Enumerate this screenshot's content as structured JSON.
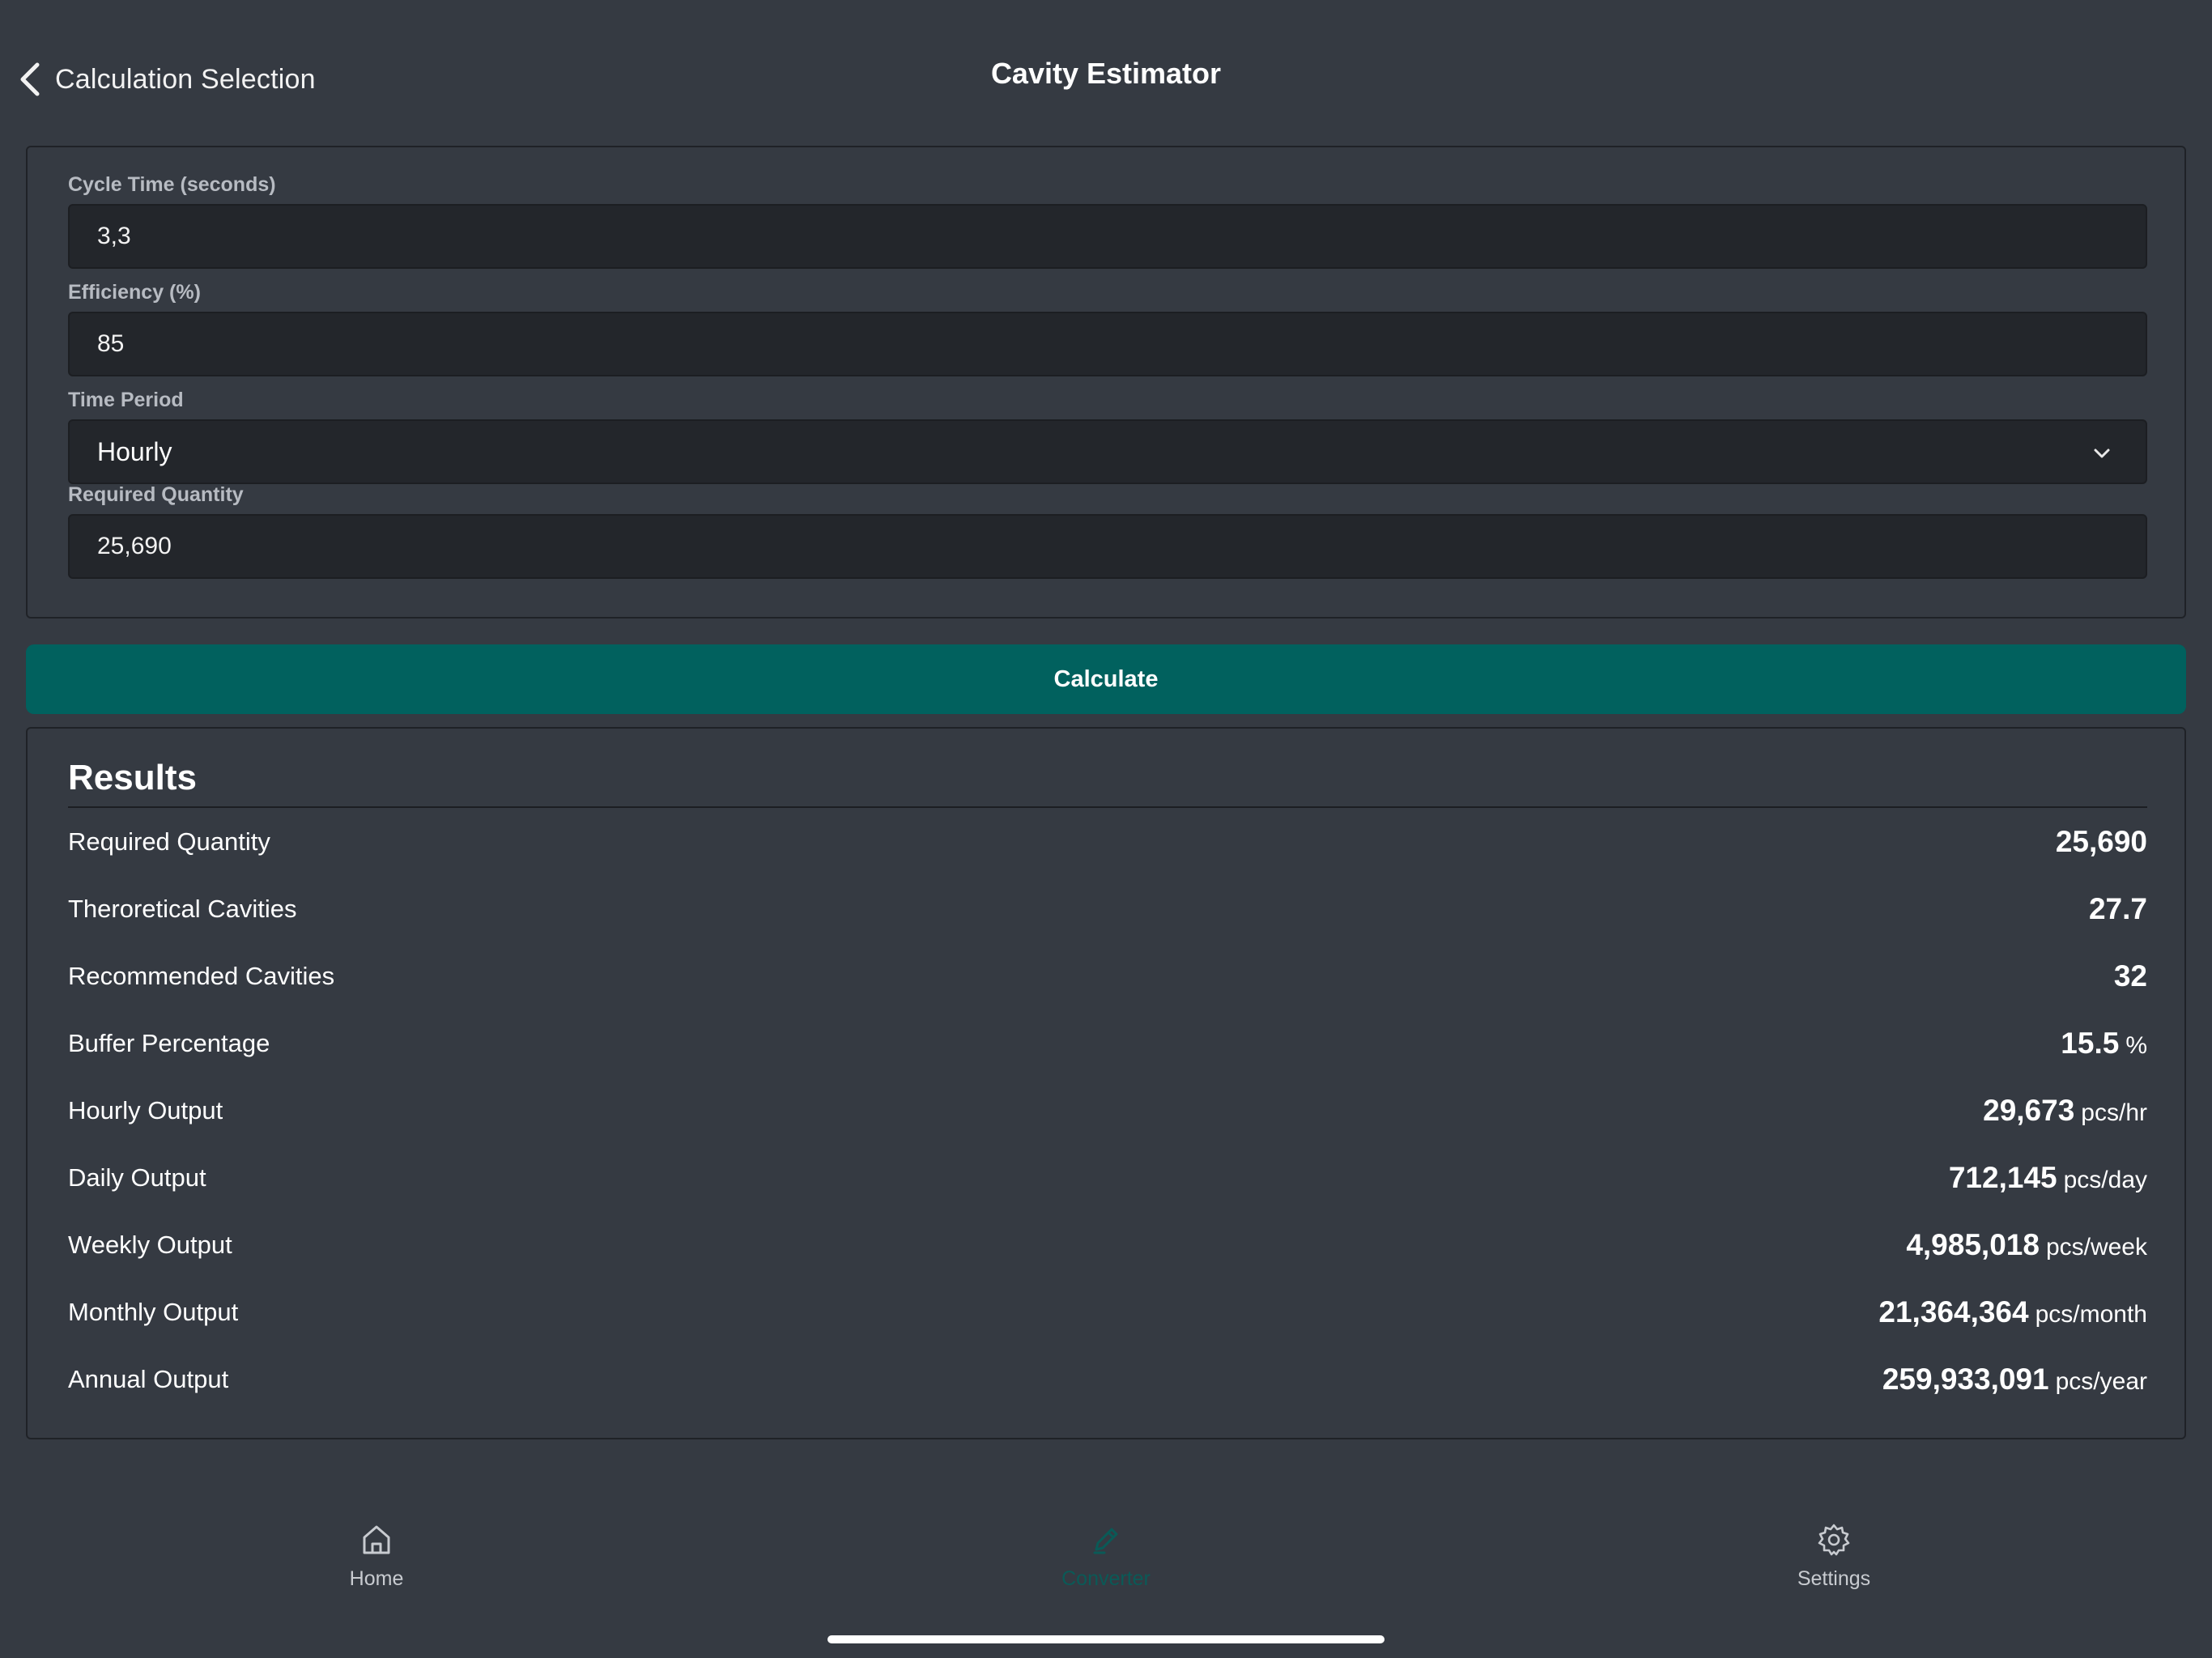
{
  "header": {
    "back_label": "Calculation Selection",
    "title": "Cavity Estimator"
  },
  "form": {
    "cycle_time": {
      "label": "Cycle Time (seconds)",
      "value": "3,3"
    },
    "efficiency": {
      "label": "Efficiency (%)",
      "value": "85"
    },
    "time_period": {
      "label": "Time Period",
      "value": "Hourly"
    },
    "required_quantity": {
      "label": "Required Quantity",
      "value": "25,690"
    }
  },
  "calculate_label": "Calculate",
  "results": {
    "title": "Results",
    "rows": [
      {
        "label": "Required Quantity",
        "value": "25,690",
        "unit": ""
      },
      {
        "label": "Theroretical Cavities",
        "value": "27.7",
        "unit": ""
      },
      {
        "label": "Recommended Cavities",
        "value": "32",
        "unit": ""
      },
      {
        "label": "Buffer Percentage",
        "value": "15.5",
        "unit": "%"
      },
      {
        "label": "Hourly Output",
        "value": "29,673",
        "unit": "pcs/hr"
      },
      {
        "label": "Daily Output",
        "value": "712,145",
        "unit": "pcs/day"
      },
      {
        "label": "Weekly Output",
        "value": "4,985,018",
        "unit": "pcs/week"
      },
      {
        "label": "Monthly Output",
        "value": "21,364,364",
        "unit": "pcs/month"
      },
      {
        "label": "Annual Output",
        "value": "259,933,091",
        "unit": "pcs/year"
      }
    ]
  },
  "tabs": [
    {
      "label": "Home",
      "icon": "home-icon",
      "active": false
    },
    {
      "label": "Converter",
      "icon": "pencil-icon",
      "active": true
    },
    {
      "label": "Settings",
      "icon": "gear-icon",
      "active": false
    }
  ],
  "colors": {
    "background": "#353a42",
    "input_background": "#23262b",
    "accent": "#01615e",
    "active_tab": "#0a5a57"
  }
}
